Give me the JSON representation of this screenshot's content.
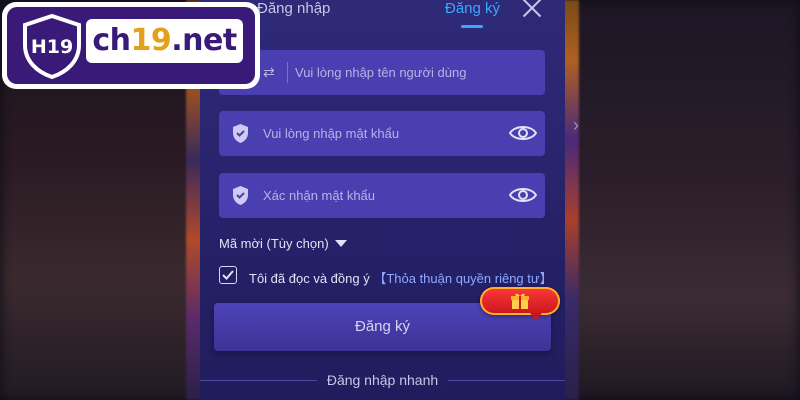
{
  "brand": {
    "shield_text": "H19",
    "site_prefix": "ch",
    "site_num": "19",
    "site_suffix": ".net"
  },
  "tabs": {
    "login": "Đăng nhập",
    "register": "Đăng ký"
  },
  "fields": {
    "username_placeholder": "Vui lòng nhập tên người dùng",
    "password_placeholder": "Vui lòng nhập mật khẩu",
    "confirm_placeholder": "Xác nhận mật khẩu"
  },
  "invite_label": "Mã mời (Tùy chọn)",
  "agreement": {
    "text": "Tôi đã đọc và đồng ý",
    "link": "【Thỏa thuận quyền riêng tư】",
    "checked": true
  },
  "register_button": "Đăng ký",
  "quick_login": "Đăng nhập nhanh",
  "colors": {
    "modal": "#2e2a78",
    "field": "#4a3fb0",
    "accent": "#3ea6ff",
    "brand": "#3a1a78",
    "gift": "#e0141c"
  }
}
